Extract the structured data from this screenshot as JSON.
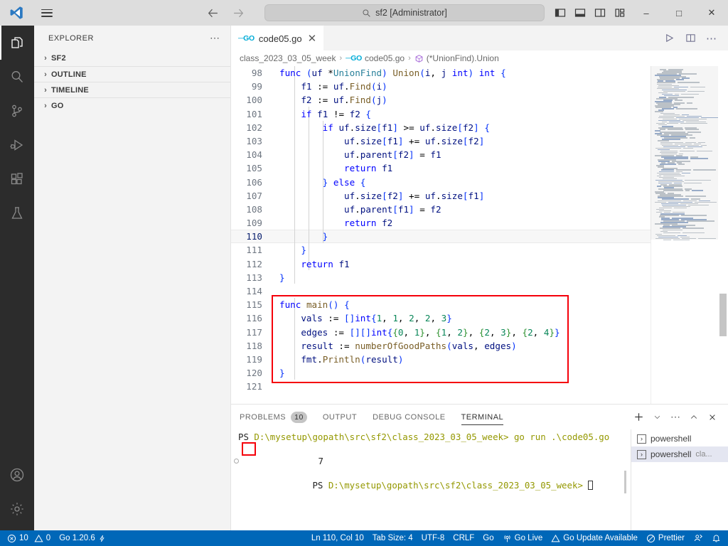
{
  "titlebar": {
    "logo_icon": "vscode-logo-icon",
    "menu_icon": "hamburger-menu-icon",
    "back_icon": "back-arrow-icon",
    "forward_icon": "forward-arrow-icon",
    "search_icon": "search-icon",
    "search_text": "sf2 [Administrator]",
    "layout_toggles": [
      {
        "name": "toggle-primary-sidebar-icon"
      },
      {
        "name": "toggle-panel-icon"
      },
      {
        "name": "toggle-secondary-sidebar-icon"
      },
      {
        "name": "customize-layout-icon"
      }
    ],
    "minimize_label": "–",
    "maximize_label": "□",
    "close_label": "✕"
  },
  "activitybar": {
    "items": [
      {
        "name": "explorer",
        "icon": "files-icon",
        "active": true
      },
      {
        "name": "search",
        "icon": "search-icon",
        "active": false
      },
      {
        "name": "source-control",
        "icon": "source-control-icon",
        "active": false
      },
      {
        "name": "run-and-debug",
        "icon": "run-debug-icon",
        "active": false
      },
      {
        "name": "extensions",
        "icon": "extensions-icon",
        "active": false
      },
      {
        "name": "testing",
        "icon": "beaker-icon",
        "active": false
      }
    ],
    "bottom": [
      {
        "name": "accounts",
        "icon": "account-icon"
      },
      {
        "name": "settings",
        "icon": "gear-icon"
      }
    ]
  },
  "sidebar": {
    "title": "EXPLORER",
    "more_actions": "⋯",
    "sections": [
      {
        "label": "SF2",
        "expanded": false
      },
      {
        "label": "OUTLINE",
        "expanded": false
      },
      {
        "label": "TIMELINE",
        "expanded": false
      },
      {
        "label": "GO",
        "expanded": false
      }
    ]
  },
  "editor": {
    "tab": {
      "label": "code05.go",
      "icon": "go-file-icon",
      "close": "✕"
    },
    "actions": [
      {
        "name": "run-code-button",
        "icon": "play-icon"
      },
      {
        "name": "split-editor-right-button",
        "icon": "split-editor-icon"
      },
      {
        "name": "more-editor-actions-button",
        "icon": "ellipsis-icon"
      }
    ],
    "breadcrumb": [
      {
        "label": "class_2023_03_05_week",
        "icon": ""
      },
      {
        "label": "code05.go",
        "icon": "go-file-icon"
      },
      {
        "label": "(*UnionFind).Union",
        "icon": "symbol-method-icon"
      }
    ],
    "first_line_number": 98,
    "lines": [
      {
        "n": 98,
        "code": "func (uf *UnionFind) Union(i, j int) int {"
      },
      {
        "n": 99,
        "code": "    f1 := uf.Find(i)"
      },
      {
        "n": 100,
        "code": "    f2 := uf.Find(j)"
      },
      {
        "n": 101,
        "code": "    if f1 != f2 {"
      },
      {
        "n": 102,
        "code": "        if uf.size[f1] >= uf.size[f2] {"
      },
      {
        "n": 103,
        "code": "            uf.size[f1] += uf.size[f2]"
      },
      {
        "n": 104,
        "code": "            uf.parent[f2] = f1"
      },
      {
        "n": 105,
        "code": "            return f1"
      },
      {
        "n": 106,
        "code": "        } else {"
      },
      {
        "n": 107,
        "code": "            uf.size[f2] += uf.size[f1]"
      },
      {
        "n": 108,
        "code": "            uf.parent[f1] = f2"
      },
      {
        "n": 109,
        "code": "            return f2"
      },
      {
        "n": 110,
        "code": "        }",
        "current": true
      },
      {
        "n": 111,
        "code": "    }"
      },
      {
        "n": 112,
        "code": "    return f1"
      },
      {
        "n": 113,
        "code": "}"
      },
      {
        "n": 114,
        "code": ""
      },
      {
        "n": 115,
        "code": "func main() {"
      },
      {
        "n": 116,
        "code": "    vals := []int{1, 1, 2, 2, 3}"
      },
      {
        "n": 117,
        "code": "    edges := [][]int{{0, 1}, {1, 2}, {2, 3}, {2, 4}}"
      },
      {
        "n": 118,
        "code": "    result := numberOfGoodPaths(vals, edges)"
      },
      {
        "n": 119,
        "code": "    fmt.Println(result)"
      },
      {
        "n": 120,
        "code": "}"
      },
      {
        "n": 121,
        "code": ""
      }
    ],
    "highlight_color": "#f5000a"
  },
  "panel": {
    "tabs": [
      {
        "label": "PROBLEMS",
        "badge": "10",
        "active": false
      },
      {
        "label": "OUTPUT",
        "badge": "",
        "active": false
      },
      {
        "label": "DEBUG CONSOLE",
        "badge": "",
        "active": false
      },
      {
        "label": "TERMINAL",
        "badge": "",
        "active": true
      }
    ],
    "actions": [
      {
        "name": "new-terminal-button",
        "icon": "plus-icon"
      },
      {
        "name": "terminal-profile-dropdown-button",
        "icon": "chevron-down-icon"
      },
      {
        "name": "panel-more-actions-button",
        "icon": "ellipsis-icon"
      },
      {
        "name": "maximize-panel-button",
        "icon": "chevron-up-icon"
      },
      {
        "name": "close-panel-button",
        "icon": "close-icon"
      }
    ],
    "terminal": {
      "prompt_label": "PS",
      "path": "D:\\mysetup\\gopath\\src\\sf2\\class_2023_03_05_week>",
      "command": "go run .\\code05.go",
      "output": "7",
      "output_highlighted": true,
      "cursor": "█"
    },
    "terminal_list": [
      {
        "label": "powershell",
        "sub": "",
        "selected": false,
        "icon": "terminal-icon"
      },
      {
        "label": "powershell",
        "sub": "cla...",
        "selected": true,
        "icon": "terminal-icon"
      }
    ]
  },
  "statusbar": {
    "left": [
      {
        "name": "problems-errors",
        "icon": "error-icon",
        "label": "10"
      },
      {
        "name": "problems-warnings",
        "icon": "warning-icon",
        "label": "0"
      },
      {
        "name": "go-version",
        "icon": "",
        "label": "Go 1.20.6"
      },
      {
        "name": "go-lightning",
        "icon": "lightning-icon",
        "label": ""
      }
    ],
    "right": [
      {
        "name": "editor-position",
        "icon": "",
        "label": "Ln 110, Col 10"
      },
      {
        "name": "indentation",
        "icon": "",
        "label": "Tab Size: 4"
      },
      {
        "name": "encoding",
        "icon": "",
        "label": "UTF-8"
      },
      {
        "name": "eol",
        "icon": "",
        "label": "CRLF"
      },
      {
        "name": "language-mode",
        "icon": "",
        "label": "Go"
      },
      {
        "name": "go-live",
        "icon": "broadcast-icon",
        "label": "Go Live"
      },
      {
        "name": "go-update-available",
        "icon": "warning-icon",
        "label": "Go Update Available"
      },
      {
        "name": "prettier",
        "icon": "prettier-icon",
        "label": "Prettier"
      },
      {
        "name": "remote-feedback",
        "icon": "feedback-icon",
        "label": ""
      },
      {
        "name": "notifications",
        "icon": "bell-icon",
        "label": ""
      }
    ],
    "background": "#0067b8"
  }
}
